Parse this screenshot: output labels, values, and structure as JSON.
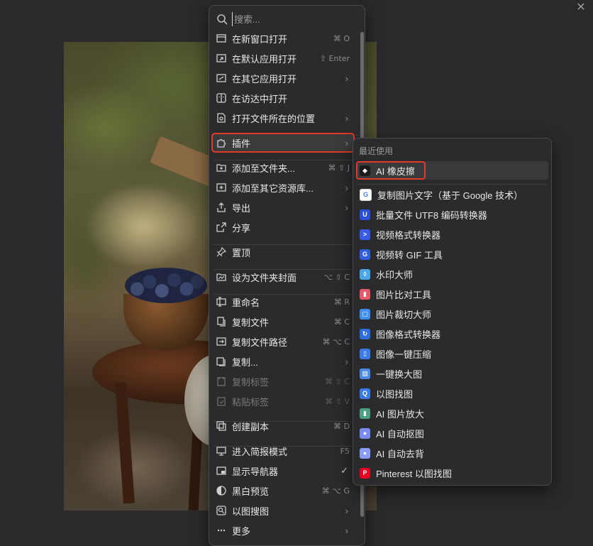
{
  "window": {
    "close_glyph": "✕"
  },
  "search": {
    "placeholder": "搜索..."
  },
  "menu": {
    "items": [
      {
        "label": "在新窗口打开",
        "shortcut": "⌘ O",
        "icon": "new-window-icon"
      },
      {
        "label": "在默认应用打开",
        "shortcut": "⇧ Enter",
        "icon": "open-default-icon"
      },
      {
        "label": "在其它应用打开",
        "submenu": true,
        "icon": "open-with-icon"
      },
      {
        "label": "在访达中打开",
        "icon": "finder-icon"
      },
      {
        "label": "打开文件所在的位置",
        "submenu": true,
        "icon": "reveal-location-icon"
      },
      {
        "label": "插件",
        "submenu": true,
        "icon": "puzzle-plugin-icon",
        "highlighted": true
      },
      {
        "label": "添加至文件夹...",
        "shortcut": "⌘ ⇧ J",
        "icon": "add-to-folder-icon"
      },
      {
        "label": "添加至其它资源库...",
        "submenu": true,
        "icon": "add-to-library-icon"
      },
      {
        "label": "导出",
        "submenu": true,
        "icon": "export-icon"
      },
      {
        "label": "分享",
        "icon": "share-icon"
      },
      {
        "label": "置顶",
        "icon": "pin-icon"
      },
      {
        "label": "设为文件夹封面",
        "shortcut": "⌥ ⇧ C",
        "icon": "folder-cover-icon"
      },
      {
        "label": "重命名",
        "shortcut": "⌘ R",
        "icon": "rename-icon"
      },
      {
        "label": "复制文件",
        "shortcut": "⌘ C",
        "icon": "copy-file-icon"
      },
      {
        "label": "复制文件路径",
        "shortcut": "⌘ ⌥ C",
        "icon": "copy-path-icon"
      },
      {
        "label": "复制...",
        "submenu": true,
        "icon": "copy-icon"
      },
      {
        "label": "复制标签",
        "shortcut": "⌘ ⇧ C",
        "icon": "copy-tags-icon",
        "disabled": true
      },
      {
        "label": "粘贴标签",
        "shortcut": "⌘ ⇧ V",
        "icon": "paste-tags-icon",
        "disabled": true
      },
      {
        "label": "创建副本",
        "shortcut": "⌘ D",
        "icon": "duplicate-icon"
      },
      {
        "label": "进入简报模式",
        "shortcut": "F5",
        "icon": "presentation-icon"
      },
      {
        "label": "显示导航器",
        "checked": true,
        "icon": "navigator-icon"
      },
      {
        "label": "黑白预览",
        "shortcut": "⌘ ⌥ G",
        "icon": "grayscale-icon"
      },
      {
        "label": "以图搜图",
        "submenu": true,
        "icon": "image-search-icon"
      },
      {
        "label": "更多",
        "submenu": true,
        "icon": "more-icon"
      }
    ]
  },
  "submenu": {
    "header": "最近使用",
    "items": [
      {
        "label": "AI 橡皮擦",
        "color": "#1c1c1e",
        "glyph": "◆",
        "highlighted": true
      },
      {
        "label": "复制图片文字（基于 Google 技术）",
        "color": "#ffffff",
        "glyph": "G"
      },
      {
        "label": "批量文件 UTF8 编码转换器",
        "color": "#2b4fd6",
        "glyph": "U"
      },
      {
        "label": "视频格式转换器",
        "color": "#3a5be8",
        "glyph": ">"
      },
      {
        "label": "视频转 GIF 工具",
        "color": "#2f5fdc",
        "glyph": "G"
      },
      {
        "label": "水印大师",
        "color": "#4aa8e8",
        "glyph": "◊"
      },
      {
        "label": "图片比对工具",
        "color": "#e85a6a",
        "glyph": "▮"
      },
      {
        "label": "图片裁切大师",
        "color": "#3f8ff0",
        "glyph": "▢"
      },
      {
        "label": "图像格式转换器",
        "color": "#2e6de0",
        "glyph": "↻"
      },
      {
        "label": "图像一键压缩",
        "color": "#3a7be6",
        "glyph": "▯"
      },
      {
        "label": "一键换大图",
        "color": "#4a8be8",
        "glyph": "▨"
      },
      {
        "label": "以图找图",
        "color": "#3a7be6",
        "glyph": "Q"
      },
      {
        "label": "AI 图片放大",
        "color": "#4aa080",
        "glyph": "▮"
      },
      {
        "label": "AI 自动抠图",
        "color": "#7a8cf0",
        "glyph": "●"
      },
      {
        "label": "AI 自动去背",
        "color": "#8a9cf8",
        "glyph": "●"
      },
      {
        "label": "Pinterest 以图找图",
        "color": "#e60023",
        "glyph": "P"
      }
    ]
  }
}
